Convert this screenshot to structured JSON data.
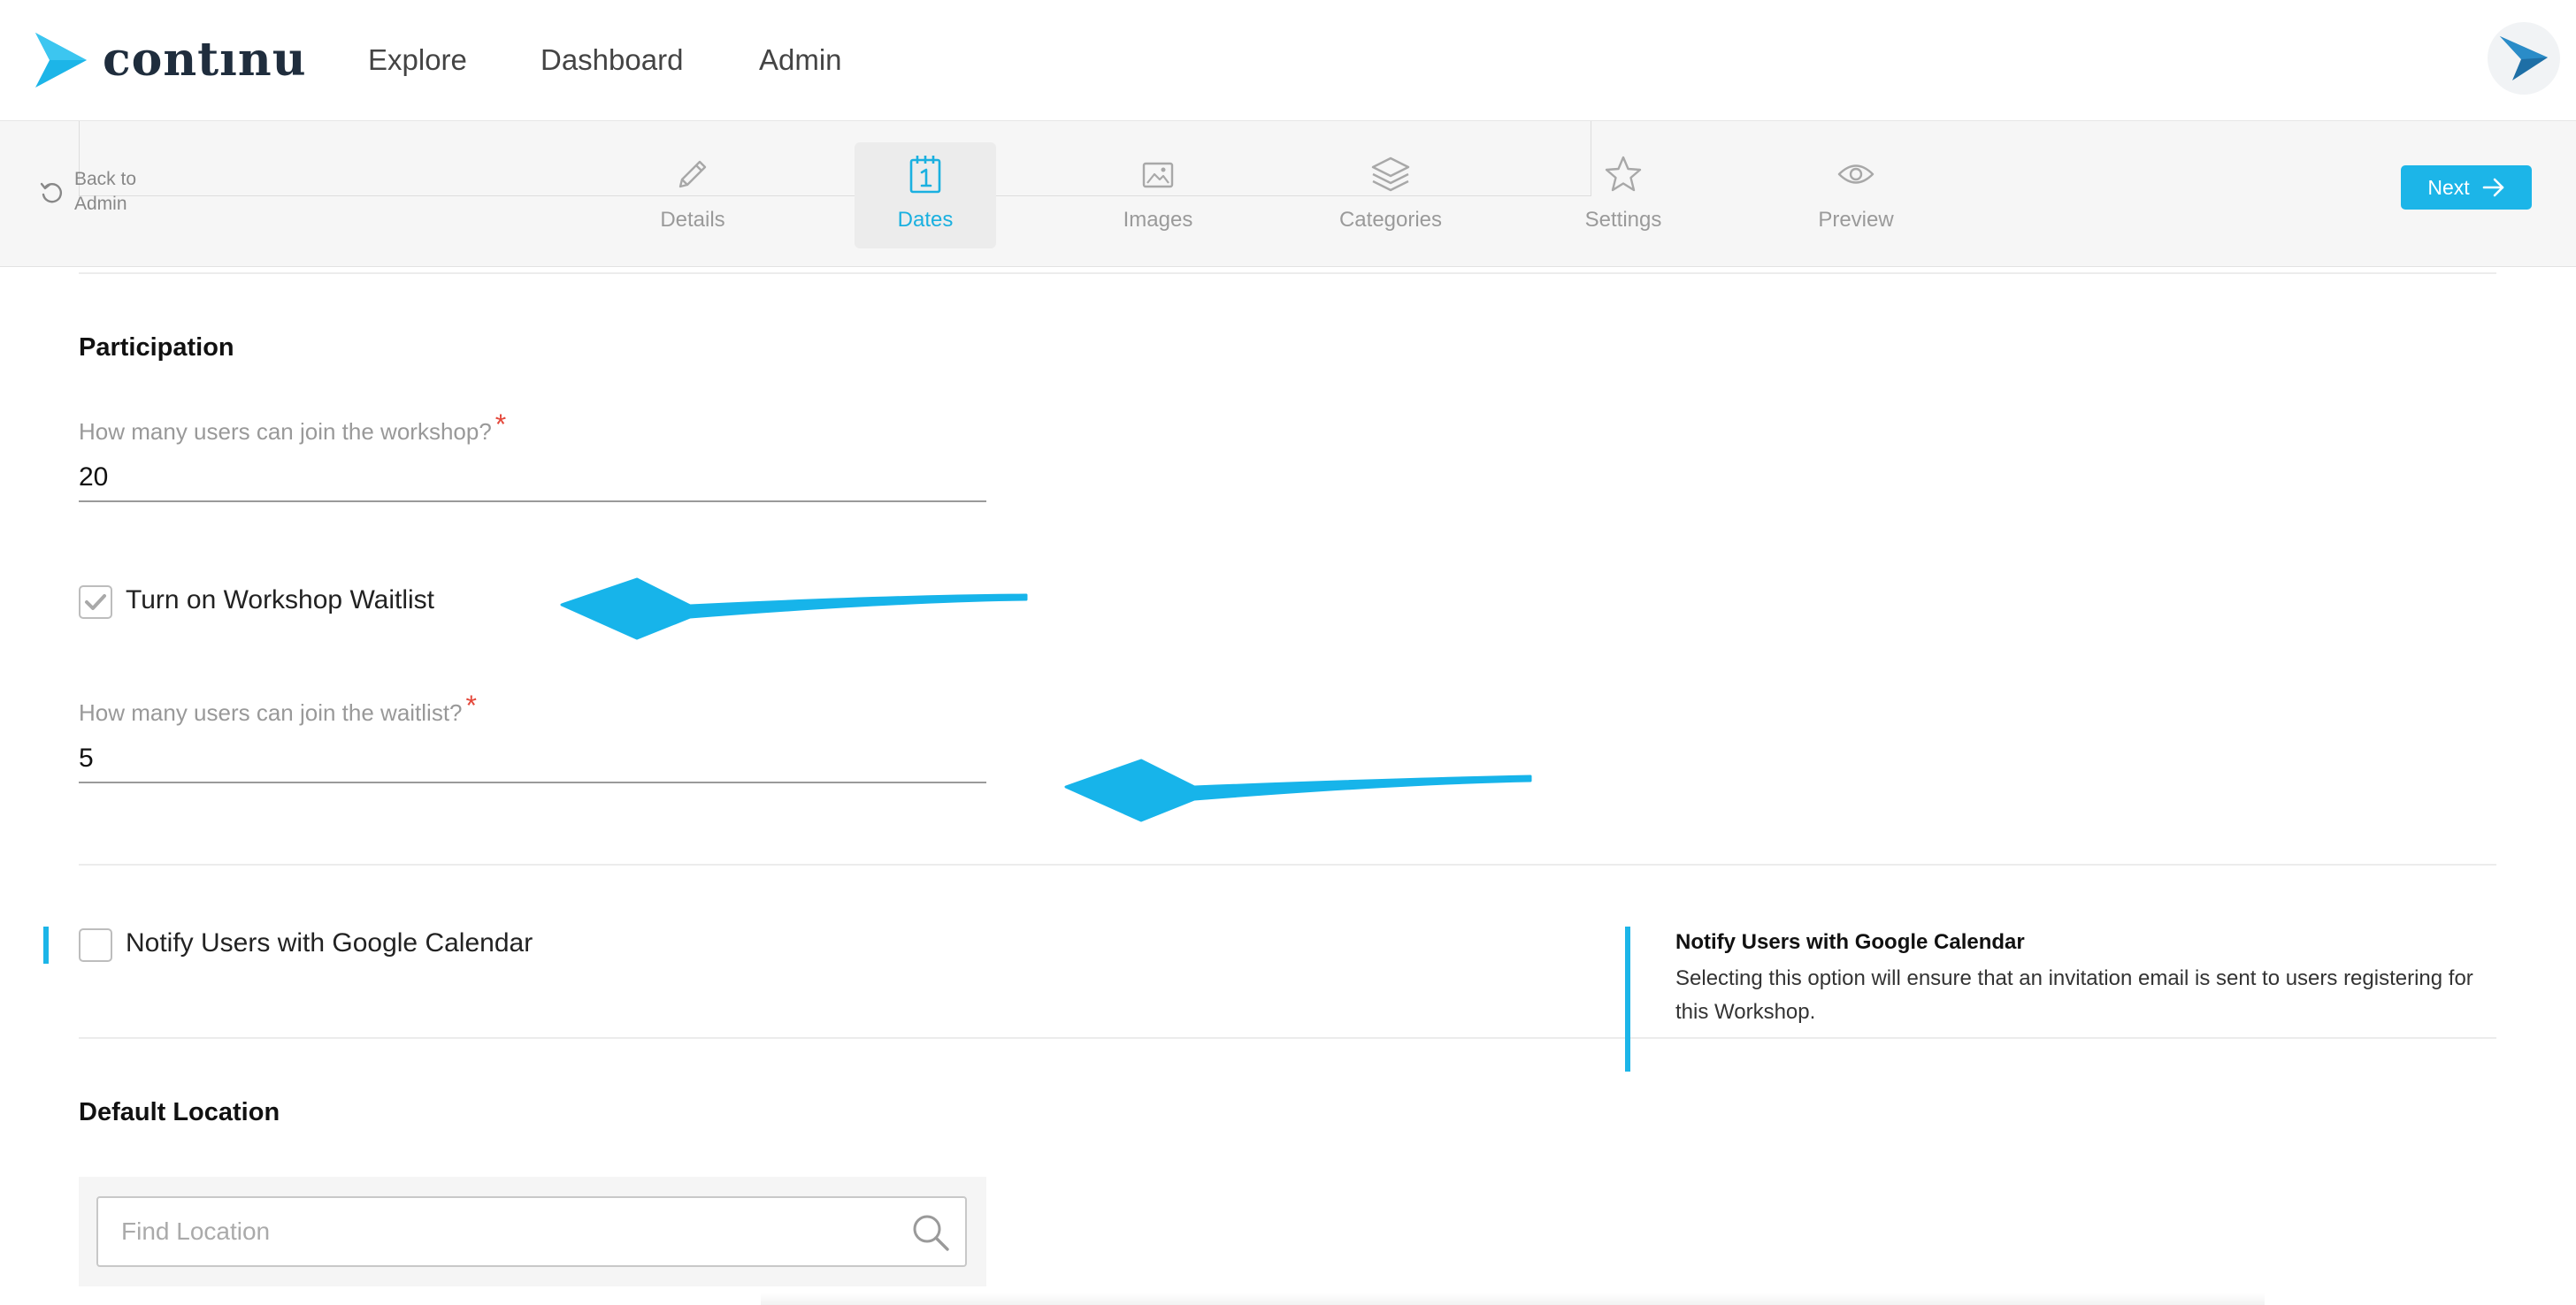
{
  "app": {
    "logo_text": "contınu",
    "nav": [
      "Explore",
      "Dashboard",
      "Admin"
    ]
  },
  "stepbar": {
    "back_label": "Back to Admin",
    "steps": [
      {
        "label": "Details",
        "icon": "pencil-icon"
      },
      {
        "label": "Dates",
        "icon": "calendar-icon",
        "active": true
      },
      {
        "label": "Images",
        "icon": "image-icon"
      },
      {
        "label": "Categories",
        "icon": "layers-icon"
      },
      {
        "label": "Settings",
        "icon": "star-icon"
      },
      {
        "label": "Preview",
        "icon": "eye-icon"
      }
    ],
    "next_label": "Next"
  },
  "participation": {
    "title": "Participation",
    "capacity_label": "How many users can join the workshop?",
    "capacity_value": "20",
    "waitlist_toggle_label": "Turn on Workshop Waitlist",
    "waitlist_enabled": true,
    "waitlist_label": "How many users can join the waitlist?",
    "waitlist_value": "5",
    "required_mark": "*"
  },
  "google_calendar": {
    "checkbox_label": "Notify Users with Google Calendar",
    "enabled": false,
    "help_title": "Notify Users with Google Calendar",
    "help_text": "Selecting this option will ensure that an invitation email is sent to users registering for this Workshop."
  },
  "location": {
    "title": "Default Location",
    "search_placeholder": "Find Location"
  },
  "colors": {
    "accent": "#1cb5e8",
    "required": "#e4483b",
    "brand_dark": "#1f2d3d"
  }
}
